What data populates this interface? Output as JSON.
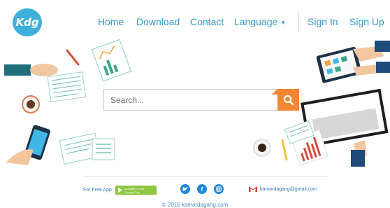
{
  "header": {
    "logo_text": "Kdg",
    "nav": {
      "home": "Home",
      "download": "Download",
      "contact": "Contact",
      "language": "Language",
      "signin": "Sign In",
      "signup": "Sign Up"
    }
  },
  "search": {
    "placeholder": "Search..."
  },
  "footer": {
    "free_app": "For Free App",
    "gplay_line1": "Available on the",
    "gplay_line2": "Google Play",
    "email": "kamardagang@gmail.com",
    "copyright": "© 2016 kamardagang.com"
  },
  "colors": {
    "brand_blue": "#3fb0dc",
    "nav_text": "#3a98c9",
    "search_button": "#f58634",
    "google_play": "#8dc63f",
    "social": "#1e88d8",
    "gmail": "#d44638"
  },
  "icons": [
    "logo",
    "caret-down-icon",
    "search-icon",
    "google-play-icon",
    "twitter-icon",
    "facebook-icon",
    "instagram-icon",
    "gmail-icon"
  ]
}
